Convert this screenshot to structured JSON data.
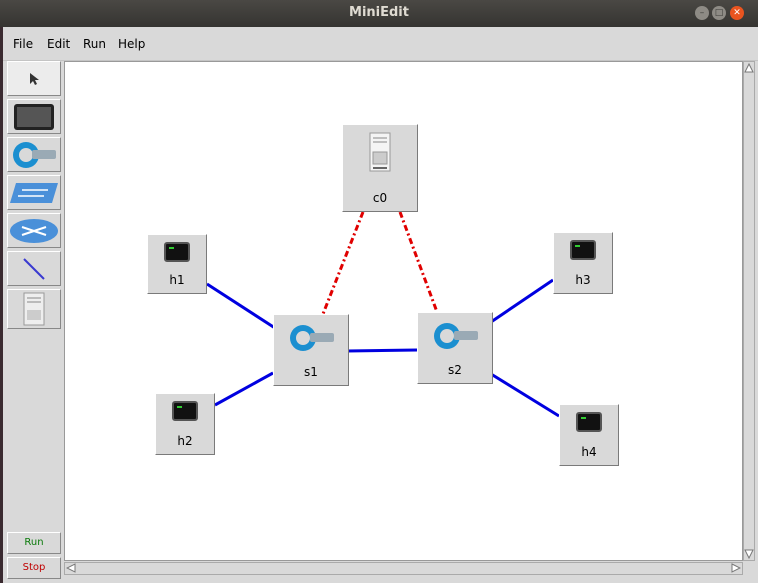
{
  "window": {
    "title": "MiniEdit"
  },
  "menu": {
    "items": [
      "File",
      "Edit",
      "Run",
      "Help"
    ]
  },
  "toolbar": {
    "tools": [
      "select-tool",
      "host-tool",
      "switch-tool",
      "legacy-switch-tool",
      "router-tool",
      "link-tool",
      "controller-tool"
    ],
    "run_label": "Run",
    "stop_label": "Stop"
  },
  "topology": {
    "nodes": [
      {
        "id": "c0",
        "type": "controller"
      },
      {
        "id": "h1",
        "type": "host"
      },
      {
        "id": "h2",
        "type": "host"
      },
      {
        "id": "h3",
        "type": "host"
      },
      {
        "id": "h4",
        "type": "host"
      },
      {
        "id": "s1",
        "type": "switch"
      },
      {
        "id": "s2",
        "type": "switch"
      }
    ],
    "links": [
      {
        "from": "h1",
        "to": "s1",
        "style": "data"
      },
      {
        "from": "h2",
        "to": "s1",
        "style": "data"
      },
      {
        "from": "s1",
        "to": "s2",
        "style": "data"
      },
      {
        "from": "s2",
        "to": "h3",
        "style": "data"
      },
      {
        "from": "s2",
        "to": "h4",
        "style": "data"
      },
      {
        "from": "c0",
        "to": "s1",
        "style": "control"
      },
      {
        "from": "c0",
        "to": "s2",
        "style": "control"
      }
    ]
  },
  "colors": {
    "data_link": "#0000e0",
    "control_link": "#e00000",
    "close_button": "#e9541f"
  }
}
